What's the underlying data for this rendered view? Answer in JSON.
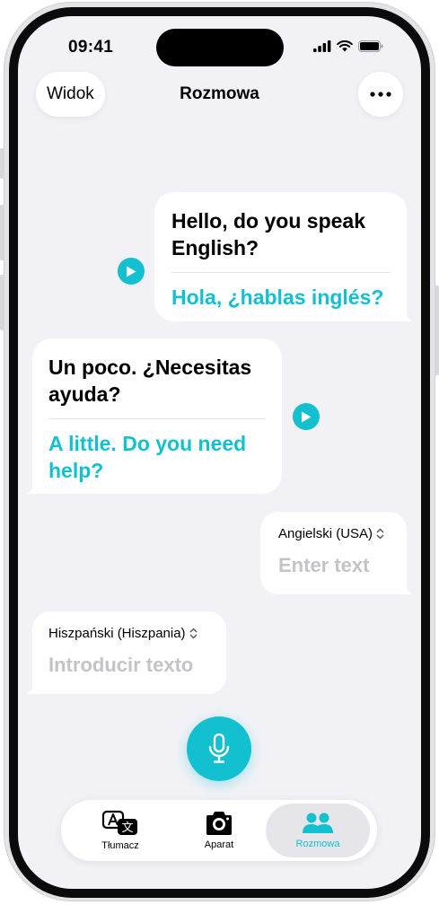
{
  "status_bar": {
    "time": "09:41"
  },
  "header": {
    "view_label": "Widok",
    "title": "Rozmowa"
  },
  "conversation": [
    {
      "source": "Hello, do you speak English?",
      "translation": "Hola, ¿hablas inglés?"
    },
    {
      "source": "Un poco. ¿Necesitas ayuda?",
      "translation": "A little. Do you need help?"
    }
  ],
  "inputs": [
    {
      "language": "Angielski (USA)",
      "placeholder": "Enter text"
    },
    {
      "language": "Hiszpański (Hiszpania)",
      "placeholder": "Introducir texto"
    }
  ],
  "tabs": [
    {
      "label": "Tłumacz",
      "icon": "translate-icon",
      "active": false
    },
    {
      "label": "Aparat",
      "icon": "camera-icon",
      "active": false
    },
    {
      "label": "Rozmowa",
      "icon": "people-icon",
      "active": true
    }
  ],
  "colors": {
    "accent": "#12c0cf",
    "background": "#f2f2f6",
    "bubble": "#ffffff"
  }
}
